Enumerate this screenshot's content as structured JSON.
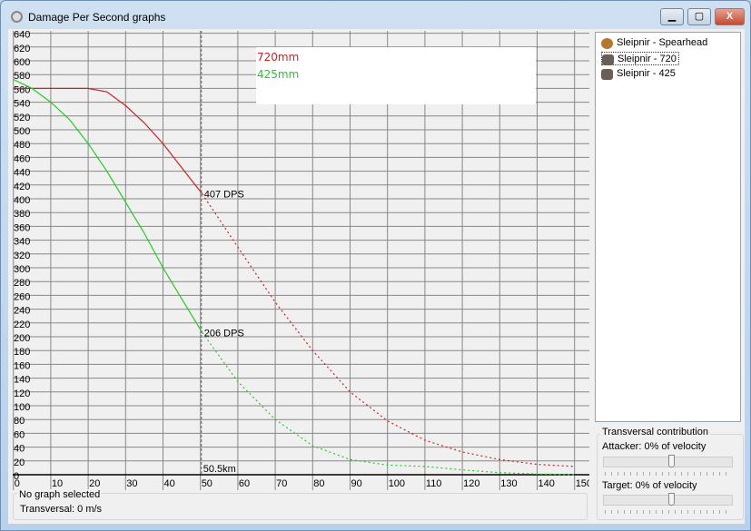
{
  "window": {
    "title": "Damage Per Second graphs",
    "minimize": "▁",
    "maximize": "▢",
    "close": "X"
  },
  "ships": [
    {
      "label": "Sleipnir - Spearhead",
      "icon": "spearhead-icon"
    },
    {
      "label": "Sleipnir - 720",
      "icon": "ship-icon",
      "selected": true
    },
    {
      "label": "Sleipnir - 425",
      "icon": "ship-icon"
    }
  ],
  "status": {
    "selection": "No graph selected",
    "transversal": "Transversal: 0 m/s"
  },
  "transversal": {
    "group_label": "Transversal contribution",
    "attacker_label": "Attacker: 0% of velocity",
    "attacker_value": 0,
    "target_label": "Target: 0% of velocity",
    "target_value": 0
  },
  "chart_data": {
    "type": "line",
    "title": "Damage Per Second graphs",
    "xlabel": "km",
    "ylabel": "DPS",
    "xlim": [
      0,
      150
    ],
    "ylim": [
      0,
      640
    ],
    "x_ticks": [
      0,
      10,
      20,
      30,
      40,
      50,
      60,
      70,
      80,
      90,
      100,
      110,
      120,
      130,
      140,
      150
    ],
    "y_ticks": [
      0,
      20,
      40,
      60,
      80,
      100,
      120,
      140,
      160,
      180,
      200,
      220,
      240,
      260,
      280,
      300,
      320,
      340,
      360,
      380,
      400,
      420,
      440,
      460,
      480,
      500,
      520,
      540,
      560,
      580,
      600,
      620,
      640
    ],
    "cursor": {
      "x": 50.5,
      "label": "50.5km"
    },
    "legend": {
      "placement": "top-center"
    },
    "series": [
      {
        "name": "720mm",
        "color": "#cc2222",
        "cursor_label": "407 DPS",
        "x": [
          0,
          10,
          20,
          25,
          30,
          35,
          40,
          45,
          50.5,
          60,
          70,
          80,
          90,
          100,
          110,
          120,
          130,
          140,
          150
        ],
        "y": [
          560,
          560,
          560,
          555,
          535,
          510,
          480,
          445,
          407,
          330,
          250,
          180,
          120,
          78,
          50,
          33,
          22,
          15,
          12
        ]
      },
      {
        "name": "425mm",
        "color": "#22cc22",
        "cursor_label": "206 DPS",
        "x": [
          0,
          5,
          10,
          15,
          20,
          25,
          30,
          35,
          40,
          45,
          50.5,
          60,
          70,
          80,
          90,
          100,
          110,
          120,
          130,
          140,
          150
        ],
        "y": [
          573,
          560,
          540,
          515,
          480,
          440,
          395,
          350,
          300,
          255,
          206,
          135,
          80,
          42,
          22,
          14,
          12,
          7,
          3,
          1,
          0
        ]
      }
    ]
  }
}
